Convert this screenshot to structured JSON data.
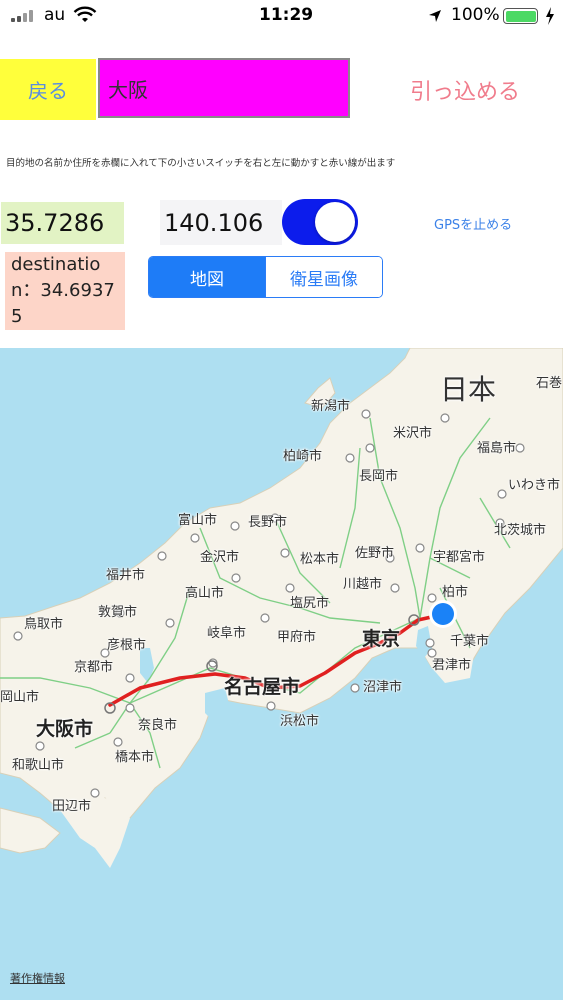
{
  "status_bar": {
    "carrier": "au",
    "time": "11:29",
    "battery": "100%"
  },
  "controls": {
    "back_label": "戻る",
    "destination_value": "大阪",
    "retract_label": "引っ込める",
    "instruction": "目的地の名前か住所を赤欄に入れて下の小さいスイッチを右と左に動かすと赤い線が出ます",
    "latitude": "35.7286",
    "longitude": "140.106",
    "gps_stop_label": "GPSを止める",
    "destination_label": "destination：34.69375",
    "toggle_on": true,
    "segments": [
      "地図",
      "衛星画像"
    ],
    "selected_segment": "地図"
  },
  "map": {
    "country_label": "日本",
    "cities": [
      "石巻",
      "新潟市",
      "米沢市",
      "福島市",
      "柏崎市",
      "長岡市",
      "いわき市",
      "富山市",
      "長野市",
      "北茨城市",
      "金沢市",
      "松本市",
      "佐野市",
      "宇都宮市",
      "福井市",
      "高山市",
      "川越市",
      "柏市",
      "鳥取市",
      "敦賀市",
      "塩尻市",
      "彦根市",
      "岐阜市",
      "甲府市",
      "東京",
      "千葉市",
      "京都市",
      "君津市",
      "名古屋市",
      "岡山市",
      "沼津市",
      "大阪市",
      "奈良市",
      "浜松市",
      "橋本市",
      "和歌山市",
      "田辺市"
    ],
    "credit": "著作権情報",
    "route_color": "#e02020",
    "location_color": "#1a82f7"
  }
}
